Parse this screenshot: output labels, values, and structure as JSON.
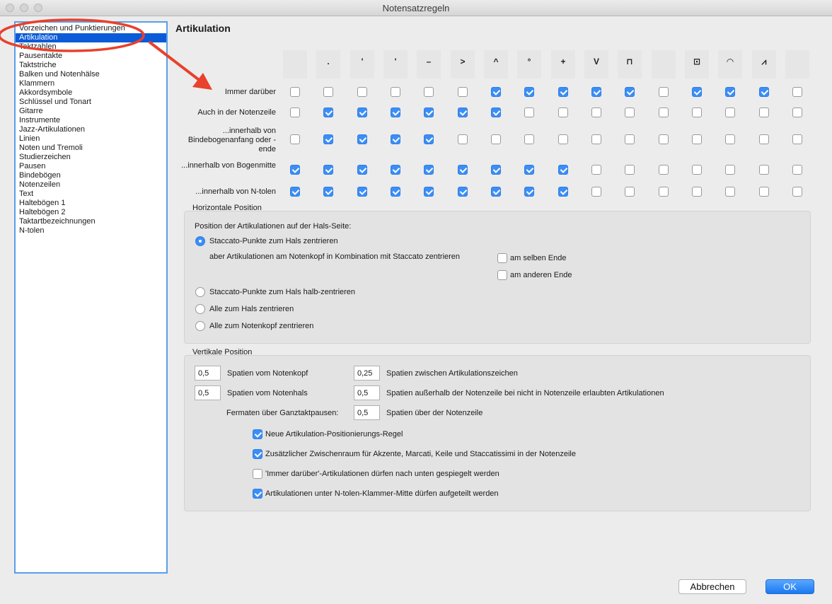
{
  "window": {
    "title": "Notensatzregeln"
  },
  "sidebar": {
    "items": [
      "Vorzeichen und Punktierungen",
      "Artikulation",
      "Taktzahlen",
      "Pausentakte",
      "Taktstriche",
      "Balken und Notenhälse",
      "Klammern",
      "Akkordsymbole",
      "Schlüssel und Tonart",
      "Gitarre",
      "Instrumente",
      "Jazz-Artikulationen",
      "Linien",
      "Noten und Tremoli",
      "Studierzeichen",
      "Pausen",
      "Bindebögen",
      "Notenzeilen",
      "Text",
      "Haltebögen 1",
      "Haltebögen 2",
      "Taktartbezeichnungen",
      "N-tolen"
    ],
    "selected_index": 1
  },
  "main": {
    "title": "Artikulation",
    "columns": [
      "",
      ".",
      "'",
      "'",
      "–",
      ">",
      "^",
      "°",
      "+",
      "V",
      "⊓",
      "",
      "⊡",
      "◠",
      "⩘",
      ""
    ],
    "rows": [
      {
        "label": "Immer darüber",
        "checks": [
          false,
          false,
          false,
          false,
          false,
          false,
          true,
          true,
          true,
          true,
          true,
          false,
          true,
          true,
          true,
          false
        ]
      },
      {
        "label": "Auch in der Notenzeile",
        "checks": [
          false,
          true,
          true,
          true,
          true,
          true,
          true,
          false,
          false,
          false,
          false,
          false,
          false,
          false,
          false,
          false
        ]
      },
      {
        "label": "...innerhalb von Bindebogenanfang oder -ende",
        "checks": [
          false,
          true,
          true,
          true,
          true,
          false,
          false,
          false,
          false,
          false,
          false,
          false,
          false,
          false,
          false,
          false
        ]
      },
      {
        "label": "...innerhalb von Bogenmitte",
        "checks": [
          true,
          true,
          true,
          true,
          true,
          true,
          true,
          true,
          true,
          false,
          false,
          false,
          false,
          false,
          false,
          false
        ]
      },
      {
        "label": "...innerhalb von N-tolen",
        "checks": [
          true,
          true,
          true,
          true,
          true,
          true,
          true,
          true,
          true,
          false,
          false,
          false,
          false,
          false,
          false,
          false
        ]
      }
    ]
  },
  "horizontal": {
    "title": "Horizontale Position",
    "intro": "Position der Artikulationen auf der Hals-Seite:",
    "radio1": "Staccato-Punkte zum Hals zentrieren",
    "sub_text": "aber Artikulationen am Notenkopf in Kombination mit Staccato zentrieren",
    "sub1": "am selben Ende",
    "sub2": "am anderen Ende",
    "radio2": "Staccato-Punkte zum Hals halb-zentrieren",
    "radio3": "Alle zum Hals zentrieren",
    "radio4": "Alle zum Notenkopf zentrieren",
    "selected": 1
  },
  "vertical": {
    "title": "Vertikale Position",
    "f1_value": "0,5",
    "f1_label": "Spatien vom Notenkopf",
    "f2_value": "0,25",
    "f2_label": "Spatien zwischen Artikulationszeichen",
    "f3_value": "0,5",
    "f3_label": "Spatien vom Notenhals",
    "f4_value": "0,5",
    "f4_label": "Spatien außerhalb der Notenzeile bei nicht in Notenzeile erlaubten Artikulationen",
    "f5_prefix": "Fermaten über Ganztaktpausen:",
    "f5_value": "0,5",
    "f5_label": "Spatien über der Notenzeile",
    "c1": "Neue Artikulation-Positionierungs-Regel",
    "c2": "Zusätzlicher Zwischenraum für Akzente, Marcati, Keile und Staccatissimi in der Notenzeile",
    "c3": "'Immer darüber'-Artikulationen dürfen nach unten gespiegelt werden",
    "c4": "Artikulationen unter N-tolen-Klammer-Mitte dürfen aufgeteilt werden"
  },
  "buttons": {
    "cancel": "Abbrechen",
    "ok": "OK"
  },
  "colors": {
    "accent": "#3b8ef5",
    "selection": "#0b5bd9",
    "annotation": "#e8412c"
  }
}
